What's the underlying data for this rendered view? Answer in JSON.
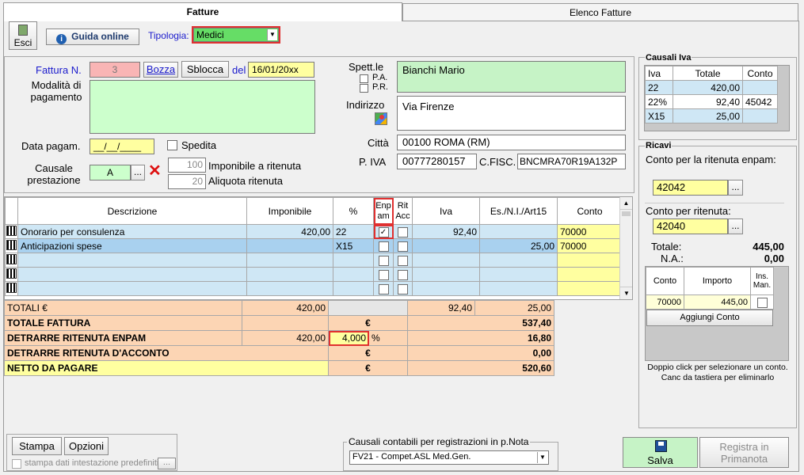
{
  "tabs": {
    "active": "Fatture",
    "inactive": "Elenco Fatture"
  },
  "toolbar": {
    "exit_label": "Esci",
    "guide_label": "Guida online",
    "tipologia_label": "Tipologia:",
    "tipologia_value": "Medici"
  },
  "invoice": {
    "number_label": "Fattura N.",
    "number_value": "3",
    "bozza_label": "Bozza",
    "sblocca_label": "Sblocca",
    "date_label": "del",
    "date_value": "16/01/20xx",
    "payment_label": "Modalità di pagamento",
    "payment_value": "",
    "pay_date_label": "Data pagam.",
    "pay_date_value": "__/__/____",
    "spedita_label": "Spedita",
    "causale_label": "Causale prestazione",
    "causale_value": "A",
    "more_label": "...",
    "imponibile_rit_value": "100",
    "imponibile_rit_label": "Imponibile a ritenuta",
    "aliquota_rit_value": "20",
    "aliquota_rit_label": "Aliquota ritenuta"
  },
  "recipient": {
    "spett_label": "Spett.le",
    "pa_label": "P.A.",
    "pr_label": "P.R.",
    "name_value": "Bianchi Mario",
    "address_label": "Indirizzo",
    "address_value": "Via Firenze",
    "city_label": "Città",
    "city_value": "00100 ROMA (RM)",
    "piva_label": "P. IVA",
    "piva_value": "00777280157",
    "cf_label": "C.FISC.",
    "cf_value": "BNCMRA70R19A132P"
  },
  "grid": {
    "headers": {
      "descrizione": "Descrizione",
      "imponibile": "Imponibile",
      "perc": "%",
      "enpam": "Enp am",
      "rit": "Rit Acc",
      "iva": "Iva",
      "esente": "Es./N.I./Art15",
      "conto": "Conto"
    },
    "rows": [
      {
        "descrizione": "Onorario per consulenza",
        "imponibile": "420,00",
        "perc": "22",
        "iva": "92,40",
        "esente": "",
        "conto": "70000"
      },
      {
        "descrizione": "Anticipazioni spese",
        "imponibile": "",
        "perc": "X15",
        "iva": "",
        "esente": "25,00",
        "conto": "70000"
      }
    ],
    "totali_label": "TOTALI €",
    "totali_imponibile": "420,00",
    "totali_iva": "92,40",
    "totali_esente": "25,00"
  },
  "summary": {
    "totale_fattura_label": "TOTALE FATTURA",
    "totale_fattura_value": "537,40",
    "euro": "€",
    "enpam_label": "DETRARRE RITENUTA ENPAM",
    "enpam_base": "420,00",
    "enpam_perc": "4,000",
    "perc_sign": "%",
    "enpam_value": "16,80",
    "acconto_label": "DETRARRE RITENUTA D'ACCONTO",
    "acconto_value": "0,00",
    "netto_label": "NETTO DA PAGARE",
    "netto_value": "520,60"
  },
  "causali_iva": {
    "title": "Causali Iva",
    "headers": {
      "iva": "Iva",
      "totale": "Totale",
      "conto": "Conto"
    },
    "rows": [
      {
        "iva": "22",
        "totale": "420,00",
        "conto": ""
      },
      {
        "iva": "22%",
        "totale": "92,40",
        "conto": "45042"
      },
      {
        "iva": "X15",
        "totale": "25,00",
        "conto": ""
      }
    ]
  },
  "ricavi": {
    "title": "Ricavi",
    "enpam_account_label": "Conto per la ritenuta enpam:",
    "enpam_account_value": "42042",
    "rit_account_label": "Conto per ritenuta:",
    "rit_account_value": "42040",
    "totale_label": "Totale:",
    "totale_value": "445,00",
    "na_label": "N.A.:",
    "na_value": "0,00",
    "table_headers": {
      "conto": "Conto",
      "importo": "Importo",
      "ins": "Ins. Man."
    },
    "table_row": {
      "conto": "70000",
      "importo": "445,00"
    },
    "add_label": "Aggiungi Conto",
    "hint": "Doppio click per selezionare un conto. Canc da tastiera per eliminarlo"
  },
  "bottom": {
    "stampa_label": "Stampa",
    "opzioni_label": "Opzioni",
    "stampa_dati_label": "stampa dati intestazione predefiniti",
    "more_label": "...",
    "causali_title": "Causali contabili per registrazioni in p.Nota",
    "causali_value": "FV21 - Compet.ASL Med.Gen.",
    "salva_label": "Salva",
    "registra_label": "Registra in Primanota"
  }
}
